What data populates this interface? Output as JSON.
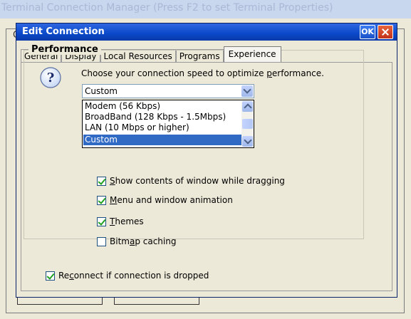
{
  "background_window": {
    "title": "Terminal Connection Manager (Press F2 to set Terminal Properties)"
  },
  "dialog": {
    "title": "Edit Connection",
    "ok_label": "OK"
  },
  "tabs": [
    {
      "label": "General"
    },
    {
      "label": "Display"
    },
    {
      "label": "Local Resources"
    },
    {
      "label": "Programs"
    },
    {
      "label": "Experience",
      "active": true
    }
  ],
  "performance": {
    "group_title": "Performance",
    "description_pre": "Choose your connection speed to optimize ",
    "description_u": "p",
    "description_post": "erformance.",
    "speed_select": {
      "value": "Custom",
      "options": [
        "Modem (56 Kbps)",
        "BroadBand (128 Kbps - 1.5Mbps)",
        "LAN (10 Mbps or higher)",
        "Custom"
      ],
      "highlighted_option": "Custom"
    },
    "checkboxes": [
      {
        "u": "S",
        "rest": "how contents of window while dragging",
        "checked": true
      },
      {
        "u": "M",
        "rest": "enu and window animation",
        "checked": true
      },
      {
        "u": "T",
        "rest": "hemes",
        "checked": true
      },
      {
        "pre": "Bitm",
        "u": "a",
        "rest": "p caching",
        "checked": false
      }
    ]
  },
  "reconnect": {
    "pre": "Re",
    "u": "c",
    "rest": "onnect if connection is dropped",
    "checked": true
  },
  "colors": {
    "titlebar": "#0a49c9",
    "selection": "#316ac5",
    "window_bg": "#ece9d8"
  }
}
